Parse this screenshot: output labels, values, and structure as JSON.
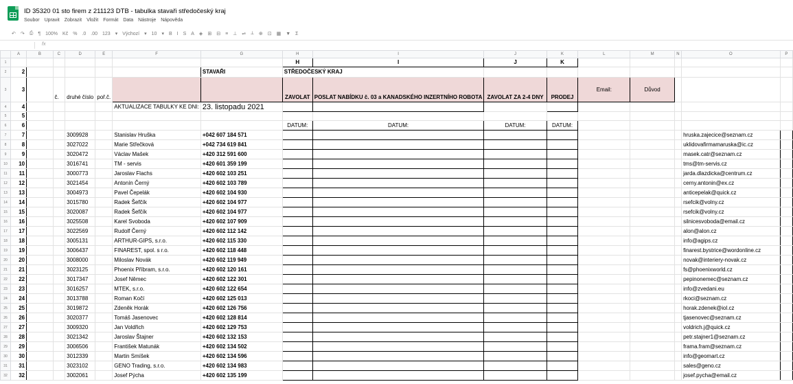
{
  "app": {
    "title": "ID 35320 01 sto firem z 211123 DTB - tabulka stavaři středočeský kraj",
    "menu": [
      "Soubor",
      "Upravit",
      "Zobrazit",
      "Vložit",
      "Formát",
      "Data",
      "Nástroje",
      "Nápověda"
    ],
    "toolbar": [
      "↶",
      "↷",
      "⎙",
      "¶",
      "100%",
      "Kč",
      "%",
      ".0",
      ".00",
      "123",
      "▾",
      "Výchozí",
      "▾",
      "10",
      "▾",
      "B",
      "I",
      "S",
      "A",
      "◈",
      "⊞",
      "⊟",
      "≡",
      "⊥",
      "⇌",
      "⟂",
      "⊕",
      "⊡",
      "▦",
      "▼",
      "Σ"
    ],
    "formula": {
      "cell": "",
      "fx": "fx"
    }
  },
  "columns": [
    "",
    "A",
    "B",
    "C",
    "D",
    "E",
    "F",
    "G",
    "H",
    "I",
    "J",
    "K",
    "L",
    "M",
    "N",
    "O",
    "P"
  ],
  "sheet": {
    "row2": {
      "num": "2",
      "title": "STAVAŘI",
      "region": "STŘEDOČESKÝ KRAJ"
    },
    "letters": {
      "H": "H",
      "I": "I",
      "J": "J",
      "K": "K"
    },
    "row3": {
      "num": "3",
      "c": "č.",
      "d": "druhé číslo",
      "e": "poř.č.",
      "h": "ZAVOLAT",
      "i": "POSLAT NABÍDKU č. 03 a KANADSKÉHO INZERTNÍHO ROBOTA",
      "j": "ZAVOLAT ZA 2-4 DNY",
      "k": "PRODEJ",
      "l": "Email:",
      "m": "Důvod"
    },
    "row4": {
      "num": "4",
      "label": "AKTUALIZACE TABULKY KE DNI:",
      "date": "23. listopadu 2021"
    },
    "row5": {
      "num": "5"
    },
    "row6": {
      "num": "6",
      "datum": "DATUM:"
    },
    "rows": [
      {
        "num": "7",
        "id": "3009928",
        "name": "Stanislav Hruška",
        "phone": "+042 607 184 571",
        "email": "hruska.zajecice@seznam.cz"
      },
      {
        "num": "8",
        "id": "3027022",
        "name": "Marie Střečková",
        "phone": "+042 734 619 841",
        "email": "uklidovafirmamaruska@ic.cz"
      },
      {
        "num": "9",
        "id": "3020472",
        "name": "Václav Mašek",
        "phone": "+420 312 591 600",
        "email": "masek.catr@seznam.cz"
      },
      {
        "num": "10",
        "id": "3016741",
        "name": "TM - servis",
        "phone": "+420 601 359 199",
        "email": "tms@tm-servis.cz"
      },
      {
        "num": "11",
        "id": "3000773",
        "name": "Jaroslav Flachs",
        "phone": "+420 602 103 251",
        "email": "jarda.dlazdicka@centrum.cz"
      },
      {
        "num": "12",
        "id": "3021454",
        "name": "Antonín Černý",
        "phone": "+420 602 103 789",
        "email": "cerny.antonin@ex.cz"
      },
      {
        "num": "13",
        "id": "3004973",
        "name": "Pavel Čepelák",
        "phone": "+420 602 104 930",
        "email": "anticepelak@quick.cz"
      },
      {
        "num": "14",
        "id": "3015780",
        "name": "Radek Šefčík",
        "phone": "+420 602 104 977",
        "email": "rsefcik@volny.cz"
      },
      {
        "num": "15",
        "id": "3020087",
        "name": "Radek Šefčík",
        "phone": "+420 602 104 977",
        "email": "rsefcik@volny.cz"
      },
      {
        "num": "16",
        "id": "3025508",
        "name": "Karel Svoboda",
        "phone": "+420 602 107 909",
        "email": "silnicesvoboda@email.cz"
      },
      {
        "num": "17",
        "id": "3022569",
        "name": "Rudolf Černý",
        "phone": "+420 602 112 142",
        "email": "alon@alon.cz"
      },
      {
        "num": "18",
        "id": "3005131",
        "name": "ARTHUR-GIPS, s.r.o.",
        "phone": "+420 602 115 330",
        "email": "info@agips.cz"
      },
      {
        "num": "19",
        "id": "3006437",
        "name": "FINAREST, spol. s r.o.",
        "phone": "+420 602 118 448",
        "email": "finarest.bystrice@wordonline.cz"
      },
      {
        "num": "20",
        "id": "3008000",
        "name": "Miloslav Novák",
        "phone": "+420 602 119 949",
        "email": "novak@interiery-novak.cz"
      },
      {
        "num": "21",
        "id": "3023125",
        "name": "Phoenix Příbram, s.r.o.",
        "phone": "+420 602 120 161",
        "email": "fs@phoenixworld.cz"
      },
      {
        "num": "22",
        "id": "3017347",
        "name": "Josef Němec",
        "phone": "+420 602 122 301",
        "email": "pepinonemec@seznam.cz"
      },
      {
        "num": "23",
        "id": "3016257",
        "name": "MTEK, s.r.o.",
        "phone": "+420 602 122 654",
        "email": "info@zvedani.eu"
      },
      {
        "num": "24",
        "id": "3013788",
        "name": "Roman Kočí",
        "phone": "+420 602 125 013",
        "email": "rkoci@seznam.cz"
      },
      {
        "num": "25",
        "id": "3019872",
        "name": "Zdeněk Horák",
        "phone": "+420 602 126 756",
        "email": "horak.zdenek@iol.cz"
      },
      {
        "num": "26",
        "id": "3020377",
        "name": "Tomáš Jasenovec",
        "phone": "+420 602 128 814",
        "email": "tjasenovec@seznam.cz"
      },
      {
        "num": "27",
        "id": "3009320",
        "name": "Jan Voldřich",
        "phone": "+420 602 129 753",
        "email": "voldrich.j@quick.cz"
      },
      {
        "num": "28",
        "id": "3021342",
        "name": "Jaroslav Štajner",
        "phone": "+420 602 132 153",
        "email": "petr.stajner1@seznam.cz"
      },
      {
        "num": "29",
        "id": "3006506",
        "name": "František Matunák",
        "phone": "+420 602 134 502",
        "email": "frama.fram@seznam.cz"
      },
      {
        "num": "30",
        "id": "3012339",
        "name": "Martin Smíšek",
        "phone": "+420 602 134 596",
        "email": "info@geomart.cz"
      },
      {
        "num": "31",
        "id": "3023102",
        "name": "GENO Trading, s.r.o.",
        "phone": "+420 602 134 983",
        "email": "sales@geno.cz"
      },
      {
        "num": "32",
        "id": "3002061",
        "name": "Josef Pýcha",
        "phone": "+420 602 135 199",
        "email": "josef.pycha@email.cz"
      }
    ]
  }
}
